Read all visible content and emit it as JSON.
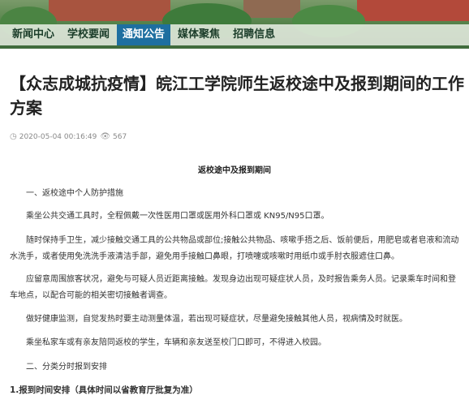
{
  "nav": {
    "items": [
      {
        "label": "新闻中心",
        "active": false
      },
      {
        "label": "学校要闻",
        "active": false
      },
      {
        "label": "通知公告",
        "active": true
      },
      {
        "label": "媒体聚焦",
        "active": false
      },
      {
        "label": "招聘信息",
        "active": false
      }
    ]
  },
  "article": {
    "title": "【众志成城抗疫情】皖江工学院师生返校途中及报到期间的工作方案",
    "date": "2020-05-04 00:16:49",
    "views": "567",
    "section_heading": "返校途中及报到期间",
    "paragraphs": [
      "一、返校途中个人防护措施",
      "乘坐公共交通工具时，全程佩戴一次性医用口罩或医用外科口罩或 KN95/N95口罩。",
      "随时保持手卫生，减少接触交通工具的公共物品或部位;接触公共物品、咳嗽手捂之后、饭前便后，用肥皂或者皂液和流动水洗手，或者使用免洗洗手液清洁手部，避免用手接触口鼻眼，打喷嚏或咳嗽时用纸巾或手肘衣服遮住口鼻。",
      "应留意周围旅客状况，避免与可疑人员近距离接触。发现身边出现可疑症状人员，及时报告乘务人员。记录乘车时间和登车地点，以配合可能的相关密切接触者调查。",
      "做好健康监测，自觉发热时要主动测量体温，若出现可疑症状，尽量避免接触其他人员，视病情及时就医。",
      "乘坐私家车或有亲友陪同返校的学生，车辆和亲友送至校门口即可，不得进入校园。",
      "二、分类分时报到安排",
      "1.报到时间安排（具体时间以省教育厅批复为准）"
    ]
  },
  "icons": {
    "clock": "clock-icon",
    "eye": "eye-icon"
  }
}
